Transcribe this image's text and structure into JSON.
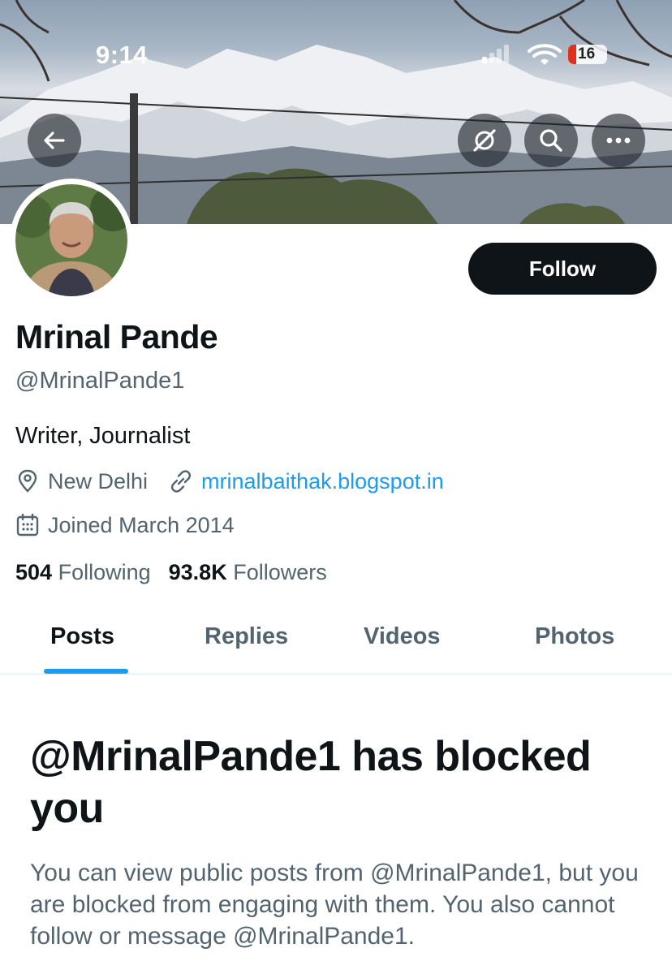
{
  "status_bar": {
    "time": "9:14",
    "battery": "16",
    "icons": [
      "cellular-signal-icon",
      "wifi-icon",
      "battery-icon"
    ]
  },
  "header": {
    "buttons": [
      "back-arrow-icon",
      "grok-icon",
      "search-icon",
      "more-icon"
    ]
  },
  "profile": {
    "name": "Mrinal Pande",
    "handle": "@MrinalPande1",
    "bio": "Writer, Journalist",
    "location": "New Delhi",
    "website": "mrinalbaithak.blogspot.in",
    "joined": "Joined March 2014",
    "following_count": "504",
    "following_label": "Following",
    "followers_count": "93.8K",
    "followers_label": "Followers",
    "follow_button": "Follow"
  },
  "tabs": [
    {
      "label": "Posts",
      "active": true
    },
    {
      "label": "Replies",
      "active": false
    },
    {
      "label": "Videos",
      "active": false
    },
    {
      "label": "Photos",
      "active": false
    }
  ],
  "blocked": {
    "title": "@MrinalPande1 has blocked you",
    "description": "You can view public posts from @MrinalPande1, but you are blocked from engaging with them. You also cannot follow or message @MrinalPande1."
  },
  "colors": {
    "accent": "#1d9bf0",
    "text_primary": "#0f1419",
    "text_secondary": "#536471",
    "follow_button_bg": "#0f1419"
  }
}
